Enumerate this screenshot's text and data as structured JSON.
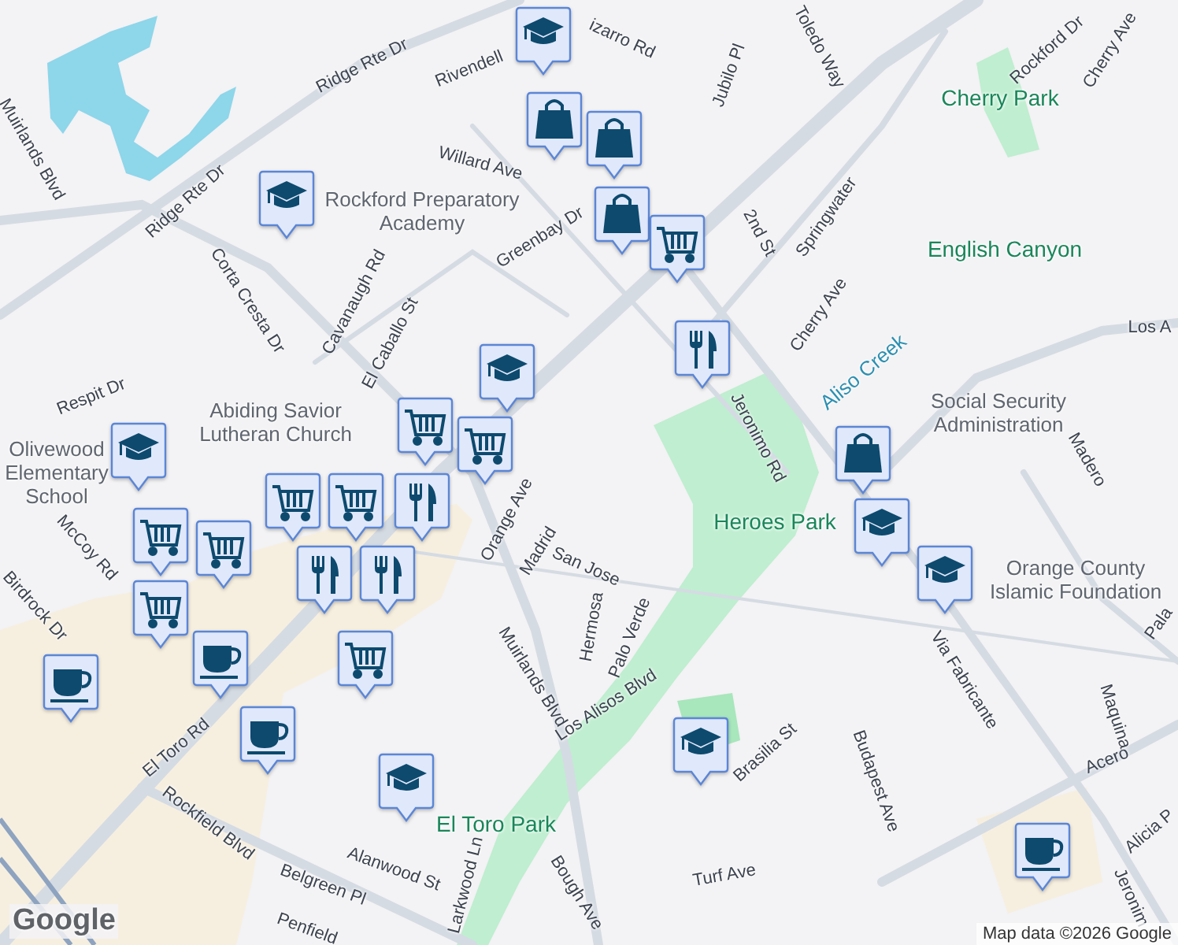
{
  "map": {
    "labels": [
      {
        "text": "Ridge Rte Dr",
        "kind": "street"
      },
      {
        "text": "Ridge Rte Dr",
        "kind": "street"
      },
      {
        "text": "Rivendell",
        "kind": "street"
      },
      {
        "text": "Willard Ave",
        "kind": "street"
      },
      {
        "text": "Greenbay Dr",
        "kind": "street"
      },
      {
        "text": "izarro Rd",
        "kind": "street"
      },
      {
        "text": "Jubilo Pl",
        "kind": "street"
      },
      {
        "text": "Toledo Way",
        "kind": "street"
      },
      {
        "text": "2nd St",
        "kind": "street"
      },
      {
        "text": "Springwater",
        "kind": "street"
      },
      {
        "text": "Cherry Ave",
        "kind": "street"
      },
      {
        "text": "Jeronimo Rd",
        "kind": "street"
      },
      {
        "text": "Rockford Dr",
        "kind": "street"
      },
      {
        "text": "Cherry Ave",
        "kind": "street"
      },
      {
        "text": "Los A",
        "kind": "street"
      },
      {
        "text": "Madero",
        "kind": "street"
      },
      {
        "text": "Via Fabricante",
        "kind": "street"
      },
      {
        "text": "Pala",
        "kind": "street"
      },
      {
        "text": "Maquina",
        "kind": "street"
      },
      {
        "text": "Acero",
        "kind": "street"
      },
      {
        "text": "Alicia P",
        "kind": "street"
      },
      {
        "text": "Jeronim",
        "kind": "street"
      },
      {
        "text": "Budapest Ave",
        "kind": "street"
      },
      {
        "text": "Brasilia St",
        "kind": "street"
      },
      {
        "text": "Turf Ave",
        "kind": "street"
      },
      {
        "text": "Los Alisos Blvd",
        "kind": "street"
      },
      {
        "text": "Palo Verde",
        "kind": "street"
      },
      {
        "text": "Hermosa",
        "kind": "street"
      },
      {
        "text": "San Jose",
        "kind": "street"
      },
      {
        "text": "Madrid",
        "kind": "street"
      },
      {
        "text": "Orange Ave",
        "kind": "street"
      },
      {
        "text": "Muirlands Blvd",
        "kind": "street"
      },
      {
        "text": "Bough Ave",
        "kind": "street"
      },
      {
        "text": "Larkwood Ln",
        "kind": "street"
      },
      {
        "text": "Alanwood St",
        "kind": "street"
      },
      {
        "text": "Belgreen Pl",
        "kind": "street"
      },
      {
        "text": "Penfield",
        "kind": "street"
      },
      {
        "text": "Rockfield Blvd",
        "kind": "street"
      },
      {
        "text": "El Toro Rd",
        "kind": "street"
      },
      {
        "text": "McCoy Rd",
        "kind": "street"
      },
      {
        "text": "Birdrock Dr",
        "kind": "street"
      },
      {
        "text": "Respit Dr",
        "kind": "street"
      },
      {
        "text": "Corta Cresta Dr",
        "kind": "street"
      },
      {
        "text": "Cavanaugh Rd",
        "kind": "street"
      },
      {
        "text": "El Caballo St",
        "kind": "street"
      },
      {
        "text": "Muirlands Blvd",
        "kind": "street"
      },
      {
        "text": "Cherry Park",
        "kind": "park"
      },
      {
        "text": "English Canyon",
        "kind": "park"
      },
      {
        "text": "Aliso Creek",
        "kind": "water"
      },
      {
        "text": "Heroes Park",
        "kind": "park"
      },
      {
        "text": "El Toro Park",
        "kind": "park"
      },
      {
        "text": "Social Security Administration",
        "kind": "place"
      },
      {
        "text": "Orange County Islamic Foundation",
        "kind": "place"
      },
      {
        "text": "Rockford Preparatory Academy",
        "kind": "place"
      },
      {
        "text": "Abiding Savior Lutheran Church",
        "kind": "place"
      },
      {
        "text": "Olivewood Elementary School",
        "kind": "place"
      }
    ],
    "pins": [
      {
        "kind": "school"
      },
      {
        "kind": "school"
      },
      {
        "kind": "school"
      },
      {
        "kind": "school"
      },
      {
        "kind": "school"
      },
      {
        "kind": "school"
      },
      {
        "kind": "school"
      },
      {
        "kind": "school"
      },
      {
        "kind": "shopping"
      },
      {
        "kind": "shopping"
      },
      {
        "kind": "shopping"
      },
      {
        "kind": "shopping"
      },
      {
        "kind": "grocery"
      },
      {
        "kind": "grocery"
      },
      {
        "kind": "grocery"
      },
      {
        "kind": "grocery"
      },
      {
        "kind": "grocery"
      },
      {
        "kind": "grocery"
      },
      {
        "kind": "grocery"
      },
      {
        "kind": "grocery"
      },
      {
        "kind": "grocery"
      },
      {
        "kind": "restaurant"
      },
      {
        "kind": "restaurant"
      },
      {
        "kind": "restaurant"
      },
      {
        "kind": "restaurant"
      },
      {
        "kind": "cafe"
      },
      {
        "kind": "cafe"
      },
      {
        "kind": "cafe"
      },
      {
        "kind": "cafe"
      }
    ],
    "logo": "Google",
    "attribution": "Map data ©2026 Google"
  }
}
